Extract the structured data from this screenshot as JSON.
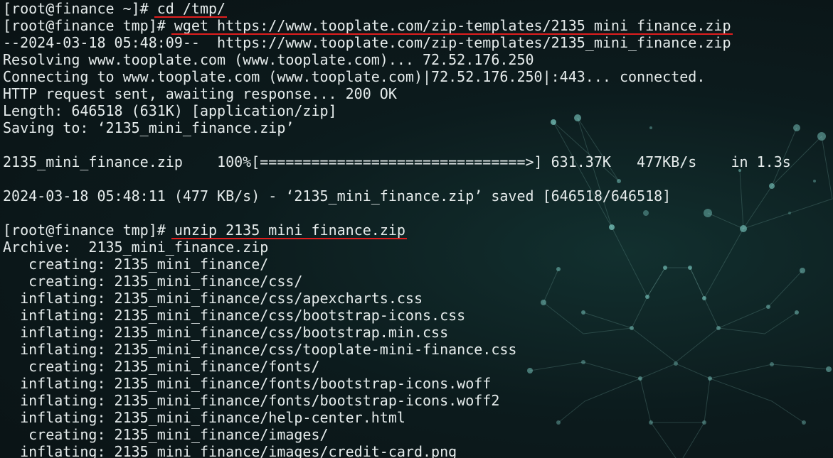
{
  "colors": {
    "background": "#0c1b1d",
    "text": "#e6ecec",
    "underline": "#e01e1e"
  },
  "terminal": {
    "lines": [
      {
        "prompt": "[root@finance ~]# ",
        "cmd": "cd /tmp/"
      },
      {
        "prompt": "[root@finance tmp]# ",
        "cmd": "wget https://www.tooplate.com/zip-templates/2135_mini_finance.zip"
      },
      {
        "text": "--2024-03-18 05:48:09--  https://www.tooplate.com/zip-templates/2135_mini_finance.zip"
      },
      {
        "text": "Resolving www.tooplate.com (www.tooplate.com)... 72.52.176.250"
      },
      {
        "text": "Connecting to www.tooplate.com (www.tooplate.com)|72.52.176.250|:443... connected."
      },
      {
        "text": "HTTP request sent, awaiting response... 200 OK"
      },
      {
        "text": "Length: 646518 (631K) [application/zip]"
      },
      {
        "text": "Saving to: ‘2135_mini_finance.zip’"
      },
      {
        "text": ""
      },
      {
        "text": "2135_mini_finance.zip    100%[===============================>] 631.37K   477KB/s    in 1.3s"
      },
      {
        "text": ""
      },
      {
        "text": "2024-03-18 05:48:11 (477 KB/s) - ‘2135_mini_finance.zip’ saved [646518/646518]"
      },
      {
        "text": ""
      },
      {
        "prompt": "[root@finance tmp]# ",
        "cmd": "unzip 2135_mini_finance.zip"
      },
      {
        "text": "Archive:  2135_mini_finance.zip"
      },
      {
        "text": "   creating: 2135_mini_finance/"
      },
      {
        "text": "   creating: 2135_mini_finance/css/"
      },
      {
        "text": "  inflating: 2135_mini_finance/css/apexcharts.css"
      },
      {
        "text": "  inflating: 2135_mini_finance/css/bootstrap-icons.css"
      },
      {
        "text": "  inflating: 2135_mini_finance/css/bootstrap.min.css"
      },
      {
        "text": "  inflating: 2135_mini_finance/css/tooplate-mini-finance.css"
      },
      {
        "text": "   creating: 2135_mini_finance/fonts/"
      },
      {
        "text": "  inflating: 2135_mini_finance/fonts/bootstrap-icons.woff"
      },
      {
        "text": "  inflating: 2135_mini_finance/fonts/bootstrap-icons.woff2"
      },
      {
        "text": "  inflating: 2135_mini_finance/help-center.html"
      },
      {
        "text": "   creating: 2135_mini_finance/images/"
      },
      {
        "text": "  inflating: 2135_mini_finance/images/credit-card.png"
      }
    ]
  }
}
